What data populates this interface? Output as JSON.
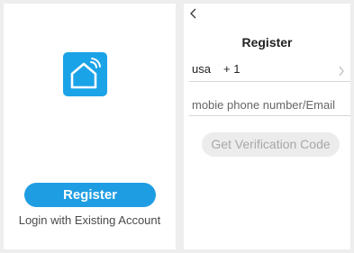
{
  "welcome": {
    "register_label": "Register",
    "login_label": "Login with Existing Account"
  },
  "register_page": {
    "title": "Register",
    "country": "usa",
    "country_code": "+ 1",
    "account_placeholder": "mobie phone number/Email",
    "verify_label": "Get Verification Code"
  },
  "icons": {
    "app_logo": "smart-home-icon",
    "back": "back-arrow-icon",
    "chevron": "chevron-right-icon"
  },
  "colors": {
    "brand": "#1ba3e8",
    "button": "#1f9de3",
    "disabled_button": "#ececec"
  }
}
